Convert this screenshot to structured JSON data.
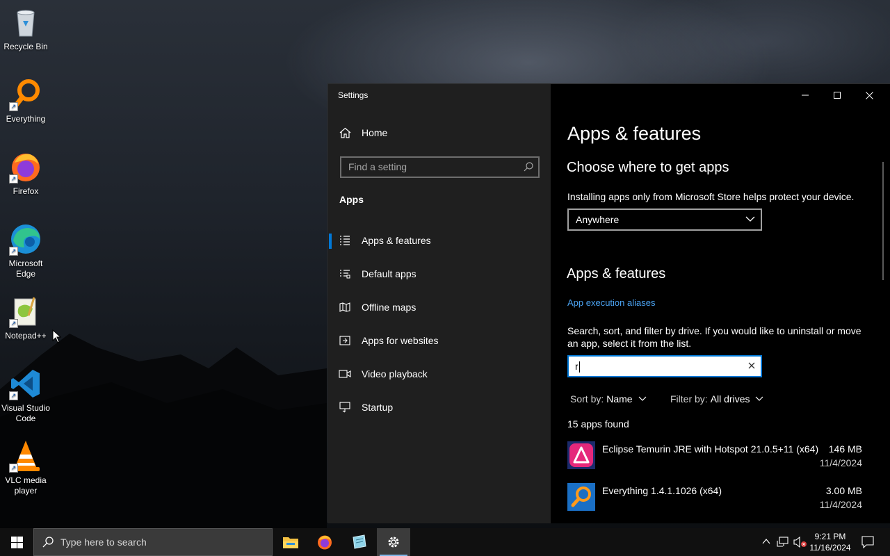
{
  "desktop": {
    "icons": [
      {
        "label": "Recycle Bin"
      },
      {
        "label": "Everything"
      },
      {
        "label": "Firefox"
      },
      {
        "label": "Microsoft Edge"
      },
      {
        "label": "Notepad++"
      },
      {
        "label": "Visual Studio Code"
      },
      {
        "label": "VLC media player"
      }
    ]
  },
  "window": {
    "title": "Settings"
  },
  "sidebar": {
    "home_label": "Home",
    "search_placeholder": "Find a setting",
    "section_title": "Apps",
    "items": [
      {
        "label": "Apps & features",
        "icon": "list-icon",
        "selected": true
      },
      {
        "label": "Default apps",
        "icon": "default-apps-icon"
      },
      {
        "label": "Offline maps",
        "icon": "map-icon"
      },
      {
        "label": "Apps for websites",
        "icon": "website-icon"
      },
      {
        "label": "Video playback",
        "icon": "video-icon"
      },
      {
        "label": "Startup",
        "icon": "startup-icon"
      }
    ]
  },
  "main": {
    "page_title": "Apps & features",
    "choose_heading": "Choose where to get apps",
    "choose_desc": "Installing apps only from Microsoft Store helps protect your device.",
    "source_selected": "Anywhere",
    "features_heading": "Apps & features",
    "aliases_link": "App execution aliases",
    "search_desc": "Search, sort, and filter by drive. If you would like to uninstall or move an app, select it from the list.",
    "filter_value": "r",
    "sort_label": "Sort by:",
    "sort_value": "Name",
    "filter_label": "Filter by:",
    "filter_drive": "All drives",
    "found_text": "15 apps found",
    "apps": [
      {
        "name": "Eclipse Temurin JRE with Hotspot 21.0.5+11 (x64)",
        "size": "146 MB",
        "date": "11/4/2024"
      },
      {
        "name": "Everything 1.4.1.1026 (x64)",
        "size": "3.00 MB",
        "date": "11/4/2024"
      }
    ]
  },
  "taskbar": {
    "search_placeholder": "Type here to search",
    "time": "9:21 PM",
    "date": "11/16/2024"
  },
  "colors": {
    "accent": "#0078d7",
    "link": "#4ba3f2"
  }
}
